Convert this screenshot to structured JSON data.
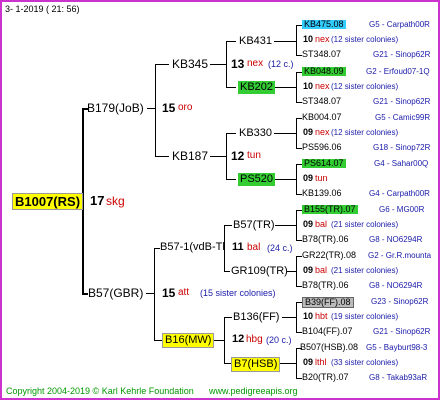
{
  "header": {
    "text": "3-   1-2019 ( 21: 56)"
  },
  "footer": {
    "copyright": "Copyright 2004-2019 © Karl Kehrle Foundation",
    "site": "www.pedigreeapis.org"
  },
  "colors": {
    "border": "#cc33cc",
    "root_box": "#ffff00",
    "highlight_yellow": "#ffff00",
    "highlight_green": "#33cc33",
    "highlight_cyan": "#33ccff",
    "highlight_gray": "#bbbbbb",
    "link_blue": "#1a1aaa",
    "note_red": "#cc0000",
    "footer_green": "#009900"
  },
  "root": {
    "name": "B1007(RS)",
    "num": "17",
    "code": "skg"
  },
  "gen1": [
    {
      "name": "B179(JoB)",
      "num": "15",
      "code": "oro"
    },
    {
      "name": "B57(GBR)",
      "num": "15",
      "code": "att",
      "note": "(15 sister colonies)"
    }
  ],
  "gen2": [
    {
      "name": "KB345",
      "num": "13",
      "code": "nex",
      "note": "(12 c.)"
    },
    {
      "name": "KB187",
      "num": "12",
      "code": "tun"
    },
    {
      "name": "B57-1(vdB-Tl",
      "num": "11",
      "code": "bal",
      "note": "(24 c.)"
    },
    {
      "name": "B16(MW)",
      "num": "12",
      "code": "hbg",
      "note": "(20 c.)"
    }
  ],
  "gen3": [
    {
      "name": "KB431"
    },
    {
      "name": "KB202"
    },
    {
      "name": "KB330"
    },
    {
      "name": "PS520"
    },
    {
      "name": "B57(TR)"
    },
    {
      "name": "GR109(TR)"
    },
    {
      "name": "B136(FF)"
    },
    {
      "name": "B7(HSB)"
    }
  ],
  "gen4": [
    {
      "top": "KB475.08",
      "top_tag": "G5 - Carpath00R",
      "num": "10",
      "code": "nex",
      "note": "(12 sister colonies)",
      "bottom": "ST348.07",
      "bottom_tag": "G21 - Sinop62R"
    },
    {
      "top": "KB048.09",
      "top_tag": "G2 - Erfoud07-1Q",
      "num": "10",
      "code": "nex",
      "note": "(12 sister colonies)",
      "bottom": "ST348.07",
      "bottom_tag": "G21 - Sinop62R"
    },
    {
      "top": "KB004.07",
      "top_tag": "G5 - Camic99R",
      "num": "09",
      "code": "nex",
      "note": "(12 sister colonies)",
      "bottom": "PS596.06",
      "bottom_tag": "G18 - Sinop72R"
    },
    {
      "top": "PS614.07",
      "top_tag": "G4 - Sahar00Q",
      "num": "09",
      "code": "tun",
      "note": "",
      "bottom": "KB139.06",
      "bottom_tag": "G4 - Carpath00R"
    },
    {
      "top": "B155(TR).07",
      "top_tag": "G6 - MG00R",
      "num": "09",
      "code": "bal",
      "note": "(21 sister colonies)",
      "bottom": "B78(TR).06",
      "bottom_tag": "G8 - NO6294R"
    },
    {
      "top": "GR22(TR).08",
      "top_tag": "G2 - Gr.R.mounta",
      "num": "09",
      "code": "bal",
      "note": "(21 sister colonies)",
      "bottom": "B78(TR).06",
      "bottom_tag": "G8 - NO6294R"
    },
    {
      "top": "B39(FF).08",
      "top_tag": "G23 - Sinop62R",
      "num": "10",
      "code": "hbt",
      "note": "(19 sister colonies)",
      "bottom": "B104(FF).07",
      "bottom_tag": "G21 - Sinop62R"
    },
    {
      "top": "B507(HSB).08",
      "top_tag": "G5 - Bayburt98-3",
      "num": "09",
      "code": "lthl",
      "note": "(33 sister colonies)",
      "bottom": "B20(TR).07",
      "bottom_tag": "G8 - Takab93aR"
    }
  ]
}
